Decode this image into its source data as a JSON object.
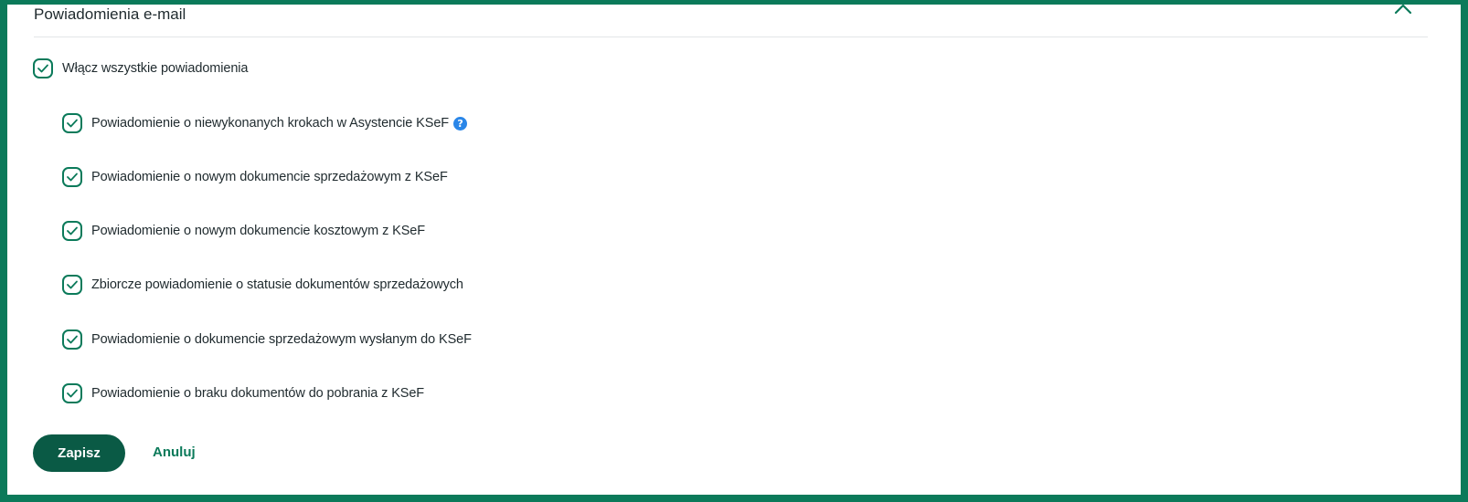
{
  "panel": {
    "title": "Powiadomienia e-mail",
    "collapse_icon": "chevron-up-icon"
  },
  "master_toggle": {
    "label": "Włącz wszystkie powiadomienia",
    "checked": true
  },
  "notifications": [
    {
      "label": "Powiadomienie o niewykonanych krokach w Asystencie KSeF",
      "checked": true,
      "help_icon": "?"
    },
    {
      "label": "Powiadomienie o nowym dokumencie sprzedażowym z KSeF",
      "checked": true
    },
    {
      "label": "Powiadomienie o nowym dokumencie kosztowym z KSeF",
      "checked": true
    },
    {
      "label": "Zbiorcze powiadomienie o statusie dokumentów sprzedażowych",
      "checked": true
    },
    {
      "label": "Powiadomienie o dokumencie sprzedażowym wysłanym do KSeF",
      "checked": true
    },
    {
      "label": "Powiadomienie o braku dokumentów do pobrania z KSeF",
      "checked": true
    }
  ],
  "actions": {
    "save_label": "Zapisz",
    "cancel_label": "Anuluj"
  },
  "colors": {
    "frame_border": "#0b7a5a",
    "checkbox_accent": "#0b7a5a",
    "primary_button": "#0a5a45",
    "help_icon": "#2a86e8"
  }
}
